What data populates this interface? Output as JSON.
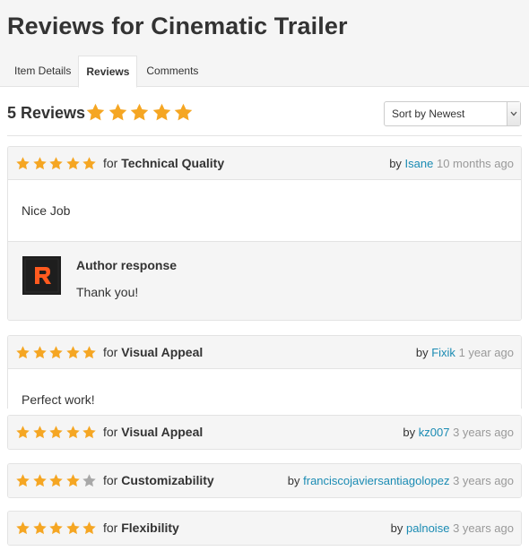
{
  "page": {
    "title": "Reviews for Cinematic Trailer"
  },
  "tabs": [
    {
      "label": "Item Details"
    },
    {
      "label": "Reviews",
      "active": true
    },
    {
      "label": "Comments"
    }
  ],
  "summary": {
    "count_label": "5 Reviews",
    "rating": 5
  },
  "sort": {
    "selected": "Sort by Newest"
  },
  "colors": {
    "star_filled": "#f5a623",
    "star_empty": "#a8a8a8",
    "link": "#1a8bb3",
    "header_bg": "#f5f5f5"
  },
  "reviews": [
    {
      "rating": 5,
      "for_label": "for",
      "category": "Technical Quality",
      "by_label": "by",
      "author": "Isane",
      "time": "10 months ago",
      "body": "Nice Job",
      "response": {
        "title": "Author response",
        "text": "Thank you!",
        "avatar_icon": "r-logo-icon"
      }
    },
    {
      "rating": 5,
      "for_label": "for",
      "category": "Visual Appeal",
      "by_label": "by",
      "author": "Fixik",
      "time": "1 year ago",
      "body": "Perfect work!"
    },
    {
      "rating": 5,
      "for_label": "for",
      "category": "Visual Appeal",
      "by_label": "by",
      "author": "kz007",
      "time": "3 years ago"
    },
    {
      "rating": 4,
      "for_label": "for",
      "category": "Customizability",
      "by_label": "by",
      "author": "franciscojaviersantiagolopez",
      "time": "3 years ago"
    },
    {
      "rating": 5,
      "for_label": "for",
      "category": "Flexibility",
      "by_label": "by",
      "author": "palnoise",
      "time": "3 years ago"
    }
  ]
}
